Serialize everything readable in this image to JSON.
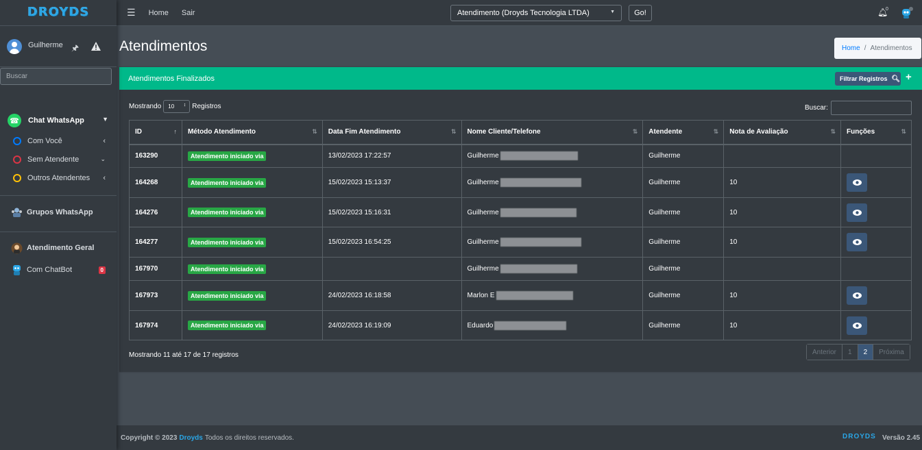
{
  "brand": {
    "name": "DROYDS"
  },
  "user": {
    "name": "Guilherme"
  },
  "sidebar": {
    "search_placeholder": "Buscar",
    "chat_whatsapp": "Chat WhatsApp",
    "sub_items": [
      {
        "label": "Com Você",
        "color": "#007bff"
      },
      {
        "label": "Sem Atendente",
        "color": "#dc3545"
      },
      {
        "label": "Outros Atendentes",
        "color": "#ffc107"
      }
    ],
    "grupos": "Grupos WhatsApp",
    "atendimento_geral": "Atendimento Geral",
    "chatbot": "Com ChatBot",
    "chatbot_badge": "0"
  },
  "topbar": {
    "home": "Home",
    "sair": "Sair",
    "company_select": "Atendimento (Droyds Tecnologia LTDA)",
    "go": "Go!",
    "bell_count": "0",
    "robot_count": "0"
  },
  "page": {
    "title": "Atendimentos",
    "breadcrumb_home": "Home",
    "breadcrumb_current": "Atendimentos"
  },
  "card": {
    "title": "Atendimentos Finalizados",
    "filter_label": "Filtrar Registros",
    "show_label": "Mostrando",
    "show_value": "10",
    "show_suffix": "Registros",
    "search_label": "Buscar:"
  },
  "table": {
    "headers": [
      "ID",
      "Método Atendimento",
      "Data Fim Atendimento",
      "Nome Cliente/Telefone",
      "Atendente",
      "Nota de Avaliação",
      "Funções"
    ],
    "rows": [
      {
        "id": "163290",
        "metodo": "Atendimento iniciado via",
        "data": "13/02/2023 17:22:57",
        "nome": "Guilherme",
        "atendente": "Guilherme",
        "nota": "",
        "eye": false
      },
      {
        "id": "164268",
        "metodo": "Atendimento iniciado via",
        "data": "15/02/2023 15:13:37",
        "nome": "Guilherme",
        "atendente": "Guilherme",
        "nota": "10",
        "eye": true
      },
      {
        "id": "164276",
        "metodo": "Atendimento iniciado via",
        "data": "15/02/2023 15:16:31",
        "nome": "Guilherme",
        "atendente": "Guilherme",
        "nota": "10",
        "eye": true
      },
      {
        "id": "164277",
        "metodo": "Atendimento iniciado via",
        "data": "15/02/2023 16:54:25",
        "nome": "Guilherme",
        "atendente": "Guilherme",
        "nota": "10",
        "eye": true
      },
      {
        "id": "167970",
        "metodo": "Atendimento iniciado via",
        "data": "",
        "nome": "Guilherme",
        "atendente": "Guilherme",
        "nota": "",
        "eye": false
      },
      {
        "id": "167973",
        "metodo": "Atendimento iniciado via",
        "data": "24/02/2023 16:18:58",
        "nome": "Marlon E",
        "atendente": "Guilherme",
        "nota": "10",
        "eye": true
      },
      {
        "id": "167974",
        "metodo": "Atendimento iniciado via",
        "data": "24/02/2023 16:19:09",
        "nome": "Eduardo",
        "atendente": "Guilherme",
        "nota": "10",
        "eye": true
      }
    ],
    "info": "Mostrando 11 até 17 de 17 registros"
  },
  "pagination": {
    "prev": "Anterior",
    "pages": [
      "1",
      "2"
    ],
    "current": "2",
    "next": "Próxima"
  },
  "footer": {
    "copyright": "Copyright © 2023",
    "brand": "Droyds",
    "rights": "Todos os direitos reservados.",
    "logo": "DROYDS",
    "version": "Versão 2.45"
  },
  "colors": {
    "accent": "#00b98a",
    "primary_btn": "#3b5778",
    "success": "#28a745",
    "danger": "#dc3545"
  }
}
